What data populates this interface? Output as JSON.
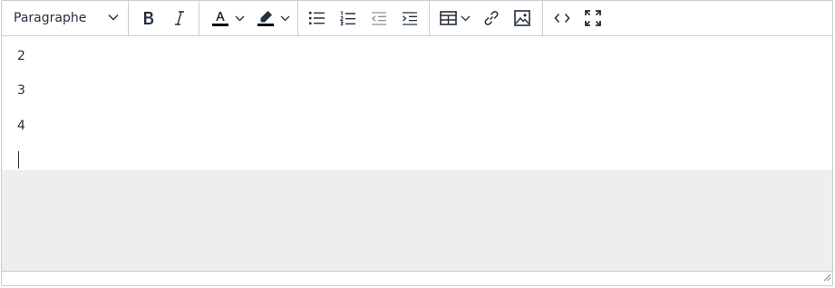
{
  "toolbar": {
    "block_format": "Paragraphe",
    "buttons": [
      {
        "name": "bold-button"
      },
      {
        "name": "italic-button"
      },
      {
        "name": "text-color-button"
      },
      {
        "name": "highlight-color-button"
      },
      {
        "name": "bullet-list-button"
      },
      {
        "name": "numbered-list-button"
      },
      {
        "name": "outdent-button"
      },
      {
        "name": "indent-button"
      },
      {
        "name": "table-button"
      },
      {
        "name": "link-button"
      },
      {
        "name": "image-button"
      },
      {
        "name": "source-code-button"
      },
      {
        "name": "fullscreen-button"
      }
    ]
  },
  "icons": {
    "bold": "bold-icon",
    "italic": "italic-icon",
    "text_color": "text-color-icon",
    "highlight": "highlight-icon",
    "bullet_list": "bullet-list-icon",
    "numbered_list": "numbered-list-icon",
    "outdent": "outdent-icon",
    "indent": "indent-icon",
    "table": "table-icon",
    "link": "link-icon",
    "image": "image-icon",
    "source_code": "code-icon",
    "fullscreen": "fullscreen-icon",
    "chevron": "chevron-down-icon",
    "resize": "resize-handle-icon"
  },
  "content": {
    "paragraphs": [
      "2",
      "3",
      "4"
    ]
  },
  "colors": {
    "text": "#222f3e",
    "border": "#cccccc",
    "empty_area": "#eeeeee"
  }
}
